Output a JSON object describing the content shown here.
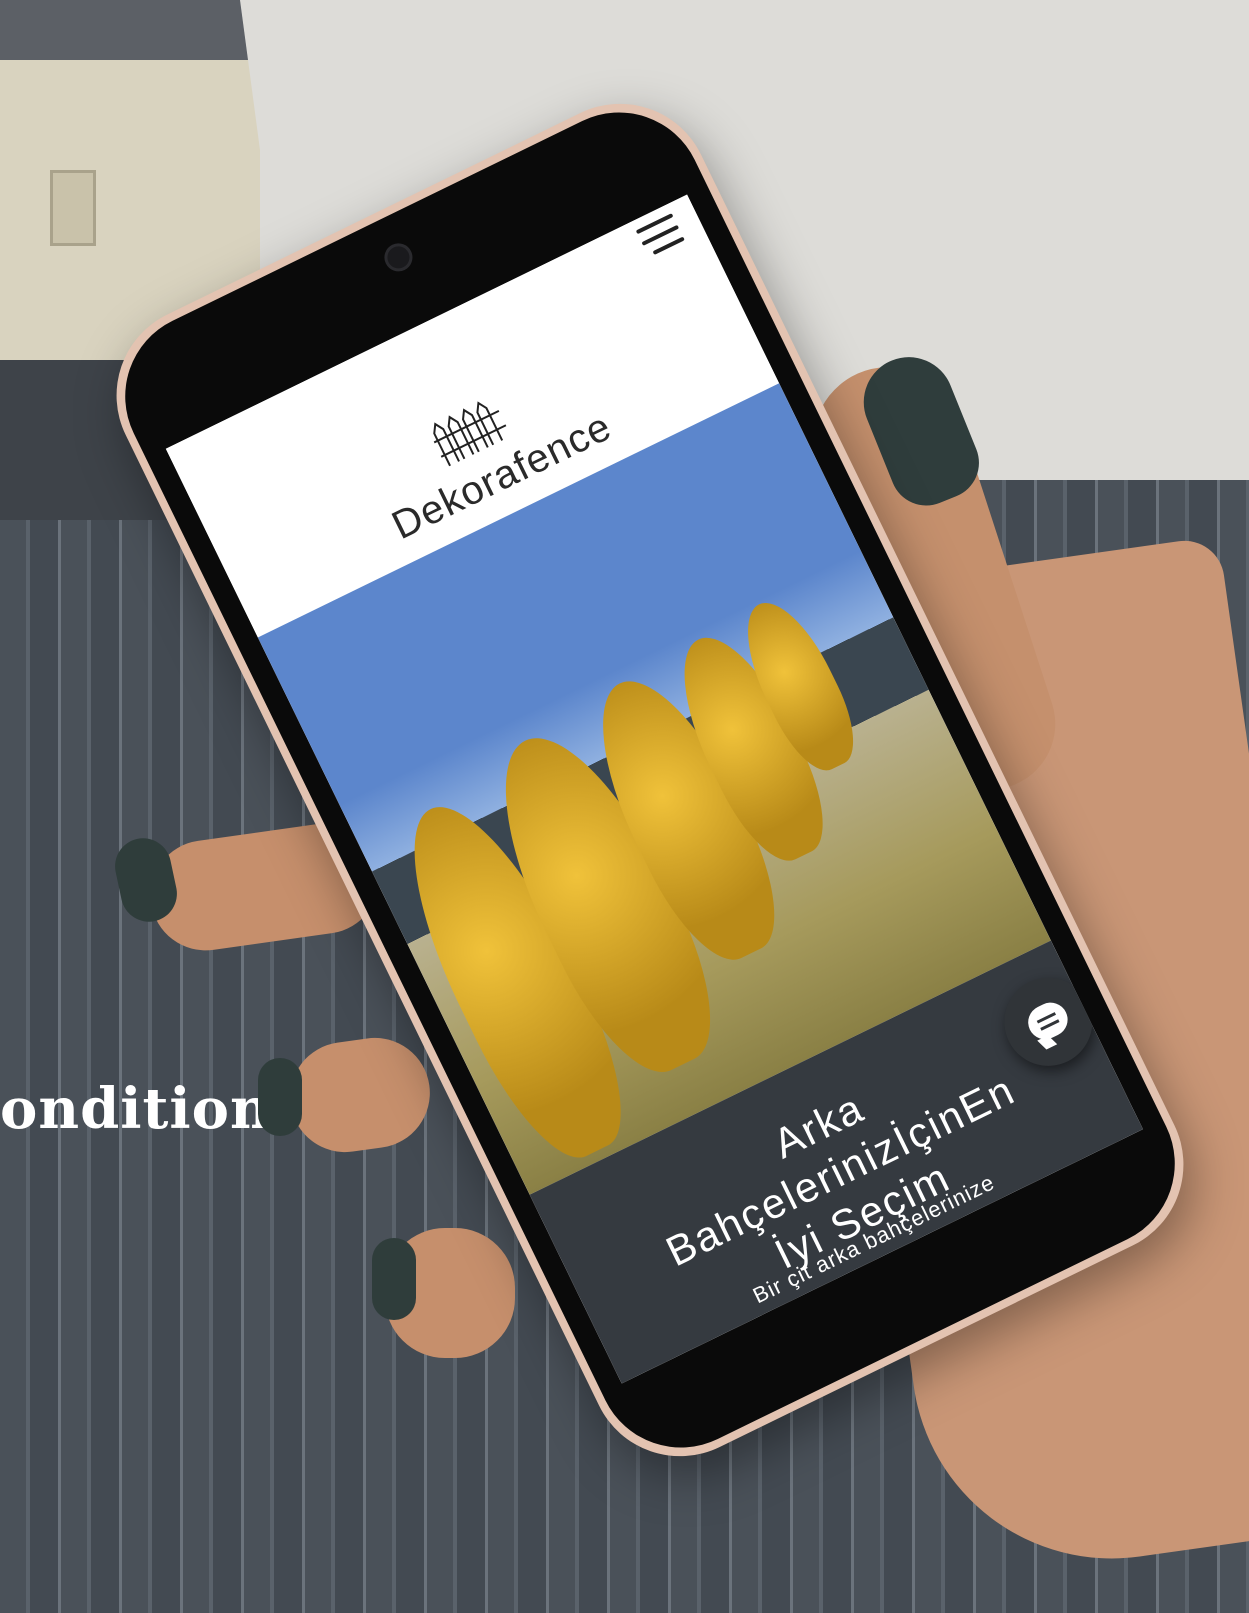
{
  "background": {
    "partial_text": "onditions"
  },
  "site": {
    "brand_name": "Dekorafence",
    "hero_title": "Arka BahçelerinizİçinEn İyi Seçim",
    "hero_title_lines": [
      "Arka",
      "BahçelerinizİçinEn",
      "İyi Seçim"
    ],
    "hero_subtitle": "Bir çit arka bahçelerinize"
  },
  "icons": {
    "menu": "hamburger-menu-icon",
    "logo": "fence-logo-icon",
    "chat": "chat-bubble-icon"
  },
  "colors": {
    "hero_panel": "#353a40",
    "header_bg": "#ffffff",
    "nail_polish": "#2f3d3b",
    "phone_frame": "#e3c3b1"
  }
}
